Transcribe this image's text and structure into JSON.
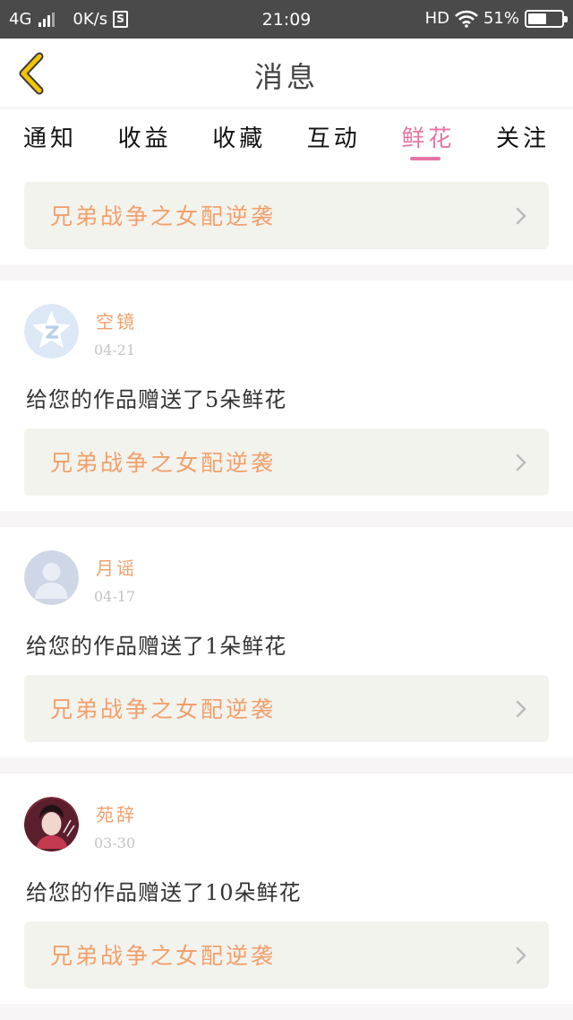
{
  "status_bar": {
    "network": "4G",
    "speed": "0K/s",
    "sim_icon": "S",
    "time": "21:09",
    "hd": "HD",
    "battery": "51%"
  },
  "header": {
    "title": "消息"
  },
  "tabs": [
    {
      "label": "通知"
    },
    {
      "label": "收益"
    },
    {
      "label": "收藏"
    },
    {
      "label": "互动"
    },
    {
      "label": "鲜花",
      "active": true
    },
    {
      "label": "关注"
    }
  ],
  "top_card": {
    "work_title": "兄弟战争之女配逆袭"
  },
  "items": [
    {
      "user": "空镜",
      "date": "04-21",
      "message": "给您的作品赠送了5朵鲜花",
      "work_title": "兄弟战争之女配逆袭",
      "avatar": "qq-default-avatar"
    },
    {
      "user": "月谣",
      "date": "04-17",
      "message": "给您的作品赠送了1朵鲜花",
      "work_title": "兄弟战争之女配逆袭",
      "avatar": "default-person-avatar"
    },
    {
      "user": "苑辞",
      "date": "03-30",
      "message": "给您的作品赠送了10朵鲜花",
      "work_title": "兄弟战争之女配逆袭",
      "avatar": "photo-avatar"
    }
  ],
  "colors": {
    "accent_pink": "#e776a4",
    "accent_orange": "#f2a06b",
    "card_bg": "#f3f3ee",
    "back_icon": "#f5c400"
  }
}
